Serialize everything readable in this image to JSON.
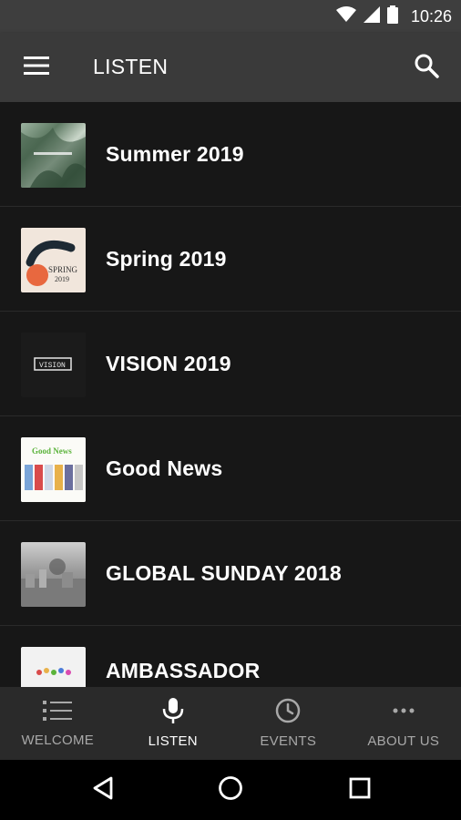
{
  "status": {
    "time": "10:26"
  },
  "appbar": {
    "title": "LISTEN"
  },
  "series": [
    {
      "label": "Summer 2019",
      "thumb": "summer"
    },
    {
      "label": "Spring 2019",
      "thumb": "spring",
      "thumb_text": "SPRING\n2019"
    },
    {
      "label": "VISION 2019",
      "thumb": "vision",
      "thumb_text": "VISION"
    },
    {
      "label": "Good News",
      "thumb": "good",
      "thumb_text": "Good News"
    },
    {
      "label": "GLOBAL SUNDAY 2018",
      "thumb": "global"
    },
    {
      "label": "AMBASSADOR",
      "thumb": "amb"
    }
  ],
  "bottomnav": [
    {
      "label": "WELCOME",
      "icon": "list-icon",
      "active": false
    },
    {
      "label": "LISTEN",
      "icon": "microphone-icon",
      "active": true
    },
    {
      "label": "EVENTS",
      "icon": "clock-icon",
      "active": false
    },
    {
      "label": "ABOUT US",
      "icon": "more-dots-icon",
      "active": false
    }
  ],
  "colors": {
    "background": "#171717",
    "appbar": "#3a3a3a",
    "nav": "#2a2a2a",
    "inactive": "#a8a8a8"
  }
}
